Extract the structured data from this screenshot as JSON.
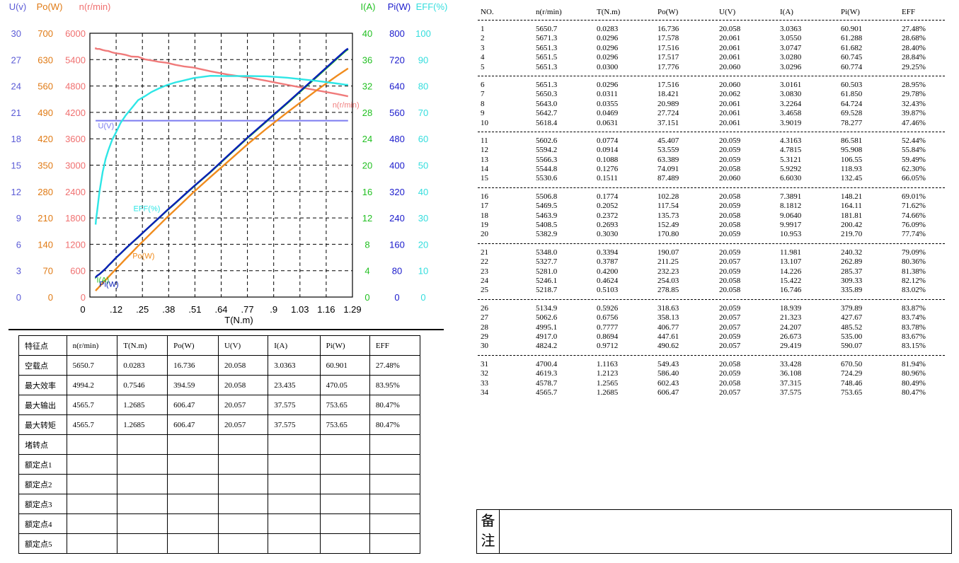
{
  "chart_data": {
    "type": "line",
    "xlabel": "T(N.m)",
    "x_ticks": [
      "0",
      ".12",
      ".25",
      ".38",
      ".51",
      ".64",
      ".77",
      ".9",
      "1.03",
      "1.16",
      "1.29"
    ],
    "xlim": [
      0,
      1.29
    ],
    "grid": true,
    "axes": [
      {
        "label": "U(v)",
        "color": "#5b5bd6",
        "side": "left",
        "min": 0,
        "max": 30,
        "ticks": [
          "0",
          "3",
          "6",
          "9",
          "12",
          "15",
          "18",
          "21",
          "24",
          "27",
          "30"
        ]
      },
      {
        "label": "Po(W)",
        "color": "#e07a14",
        "side": "left",
        "min": 0,
        "max": 700,
        "ticks": [
          "0",
          "70",
          "140",
          "210",
          "280",
          "350",
          "420",
          "490",
          "560",
          "630",
          "700"
        ]
      },
      {
        "label": "n(r/min)",
        "color": "#f07070",
        "side": "left",
        "min": 0,
        "max": 6000,
        "ticks": [
          "0",
          "600",
          "1200",
          "1800",
          "2400",
          "3000",
          "3600",
          "4200",
          "4800",
          "5400",
          "6000"
        ]
      },
      {
        "label": "I(A)",
        "color": "#22c022",
        "side": "right",
        "min": 0,
        "max": 40,
        "ticks": [
          "0",
          "4",
          "8",
          "12",
          "16",
          "20",
          "24",
          "28",
          "32",
          "36",
          "40"
        ]
      },
      {
        "label": "Pi(W)",
        "color": "#1a1acc",
        "side": "right",
        "min": 0,
        "max": 800,
        "ticks": [
          "0",
          "80",
          "160",
          "240",
          "320",
          "400",
          "480",
          "560",
          "640",
          "720",
          "800"
        ]
      },
      {
        "label": "EFF(%)",
        "color": "#33dddd",
        "side": "right",
        "min": 0,
        "max": 100,
        "ticks": [
          "0",
          "10",
          "20",
          "30",
          "40",
          "50",
          "60",
          "70",
          "80",
          "90",
          "100"
        ]
      }
    ],
    "series": [
      {
        "name": "n(r/min)",
        "axis": 2,
        "color": "#f07b7b"
      },
      {
        "name": "U(V)",
        "axis": 0,
        "color": "#7b7bf0"
      },
      {
        "name": "Po(W)",
        "axis": 1,
        "color": "#f08c1e"
      },
      {
        "name": "I(A)",
        "axis": 3,
        "color": "#22c022"
      },
      {
        "name": "Pi(W)",
        "axis": 4,
        "color": "#0a1fb8"
      },
      {
        "name": "EFF(%)",
        "axis": 5,
        "color": "#2ee6e6"
      }
    ],
    "curve_labels": [
      {
        "series": 0,
        "text": "n(r/min)"
      },
      {
        "series": 1,
        "text": "U(V)"
      },
      {
        "series": 2,
        "text": "Po(W)"
      },
      {
        "series": 3,
        "text": "I(A)"
      },
      {
        "series": 4,
        "text": "Pi(W)"
      },
      {
        "series": 5,
        "text": "EFF(%)"
      }
    ]
  },
  "columns": [
    "NO.",
    "n(r/min)",
    "T(N.m)",
    "Po(W)",
    "U(V)",
    "I(A)",
    "Pi(W)",
    "EFF"
  ],
  "rows": [
    [
      "1",
      "5650.7",
      "0.0283",
      "16.736",
      "20.058",
      "3.0363",
      "60.901",
      "27.48%"
    ],
    [
      "2",
      "5671.3",
      "0.0296",
      "17.578",
      "20.061",
      "3.0550",
      "61.288",
      "28.68%"
    ],
    [
      "3",
      "5651.3",
      "0.0296",
      "17.516",
      "20.061",
      "3.0747",
      "61.682",
      "28.40%"
    ],
    [
      "4",
      "5651.5",
      "0.0296",
      "17.517",
      "20.061",
      "3.0280",
      "60.745",
      "28.84%"
    ],
    [
      "5",
      "5651.3",
      "0.0300",
      "17.776",
      "20.060",
      "3.0296",
      "60.774",
      "29.25%"
    ],
    [
      "6",
      "5651.3",
      "0.0296",
      "17.516",
      "20.060",
      "3.0161",
      "60.503",
      "28.95%"
    ],
    [
      "7",
      "5650.3",
      "0.0311",
      "18.421",
      "20.062",
      "3.0830",
      "61.850",
      "29.78%"
    ],
    [
      "8",
      "5643.0",
      "0.0355",
      "20.989",
      "20.061",
      "3.2264",
      "64.724",
      "32.43%"
    ],
    [
      "9",
      "5642.7",
      "0.0469",
      "27.724",
      "20.061",
      "3.4658",
      "69.528",
      "39.87%"
    ],
    [
      "10",
      "5618.4",
      "0.0631",
      "37.151",
      "20.061",
      "3.9019",
      "78.277",
      "47.46%"
    ],
    [
      "11",
      "5602.6",
      "0.0774",
      "45.407",
      "20.059",
      "4.3163",
      "86.581",
      "52.44%"
    ],
    [
      "12",
      "5594.2",
      "0.0914",
      "53.559",
      "20.059",
      "4.7815",
      "95.908",
      "55.84%"
    ],
    [
      "13",
      "5566.3",
      "0.1088",
      "63.389",
      "20.059",
      "5.3121",
      "106.55",
      "59.49%"
    ],
    [
      "14",
      "5544.8",
      "0.1276",
      "74.091",
      "20.058",
      "5.9292",
      "118.93",
      "62.30%"
    ],
    [
      "15",
      "5530.6",
      "0.1511",
      "87.489",
      "20.060",
      "6.6030",
      "132.45",
      "66.05%"
    ],
    [
      "16",
      "5506.8",
      "0.1774",
      "102.28",
      "20.058",
      "7.3891",
      "148.21",
      "69.01%"
    ],
    [
      "17",
      "5469.5",
      "0.2052",
      "117.54",
      "20.059",
      "8.1812",
      "164.11",
      "71.62%"
    ],
    [
      "18",
      "5463.9",
      "0.2372",
      "135.73",
      "20.058",
      "9.0640",
      "181.81",
      "74.66%"
    ],
    [
      "19",
      "5408.5",
      "0.2693",
      "152.49",
      "20.058",
      "9.9917",
      "200.42",
      "76.09%"
    ],
    [
      "20",
      "5382.9",
      "0.3030",
      "170.80",
      "20.059",
      "10.953",
      "219.70",
      "77.74%"
    ],
    [
      "21",
      "5348.0",
      "0.3394",
      "190.07",
      "20.059",
      "11.981",
      "240.32",
      "79.09%"
    ],
    [
      "22",
      "5327.7",
      "0.3787",
      "211.25",
      "20.057",
      "13.107",
      "262.89",
      "80.36%"
    ],
    [
      "23",
      "5281.0",
      "0.4200",
      "232.23",
      "20.059",
      "14.226",
      "285.37",
      "81.38%"
    ],
    [
      "24",
      "5246.1",
      "0.4624",
      "254.03",
      "20.058",
      "15.422",
      "309.33",
      "82.12%"
    ],
    [
      "25",
      "5218.7",
      "0.5103",
      "278.85",
      "20.058",
      "16.746",
      "335.89",
      "83.02%"
    ],
    [
      "26",
      "5134.9",
      "0.5926",
      "318.63",
      "20.059",
      "18.939",
      "379.89",
      "83.87%"
    ],
    [
      "27",
      "5062.6",
      "0.6756",
      "358.13",
      "20.057",
      "21.323",
      "427.67",
      "83.74%"
    ],
    [
      "28",
      "4995.1",
      "0.7777",
      "406.77",
      "20.057",
      "24.207",
      "485.52",
      "83.78%"
    ],
    [
      "29",
      "4917.0",
      "0.8694",
      "447.61",
      "20.059",
      "26.673",
      "535.00",
      "83.67%"
    ],
    [
      "30",
      "4824.2",
      "0.9712",
      "490.62",
      "20.057",
      "29.419",
      "590.07",
      "83.15%"
    ],
    [
      "31",
      "4700.4",
      "1.1163",
      "549.43",
      "20.058",
      "33.428",
      "670.50",
      "81.94%"
    ],
    [
      "32",
      "4619.3",
      "1.2123",
      "586.40",
      "20.059",
      "36.108",
      "724.29",
      "80.96%"
    ],
    [
      "33",
      "4578.7",
      "1.2565",
      "602.43",
      "20.058",
      "37.315",
      "748.46",
      "80.49%"
    ],
    [
      "34",
      "4565.7",
      "1.2685",
      "606.47",
      "20.057",
      "37.575",
      "753.65",
      "80.47%"
    ]
  ],
  "feature_table": {
    "headers": [
      "特征点",
      "n(r/min)",
      "T(N.m)",
      "Po(W)",
      "U(V)",
      "I(A)",
      "Pi(W)",
      "EFF"
    ],
    "rows": [
      [
        "空载点",
        "5650.7",
        "0.0283",
        "16.736",
        "20.058",
        "3.0363",
        "60.901",
        "27.48%"
      ],
      [
        "最大效率",
        "4994.2",
        "0.7546",
        "394.59",
        "20.058",
        "23.435",
        "470.05",
        "83.95%"
      ],
      [
        "最大输出",
        "4565.7",
        "1.2685",
        "606.47",
        "20.057",
        "37.575",
        "753.65",
        "80.47%"
      ],
      [
        "最大转矩",
        "4565.7",
        "1.2685",
        "606.47",
        "20.057",
        "37.575",
        "753.65",
        "80.47%"
      ],
      [
        "堵转点",
        "",
        "",
        "",
        "",
        "",
        "",
        ""
      ],
      [
        "额定点1",
        "",
        "",
        "",
        "",
        "",
        "",
        ""
      ],
      [
        "额定点2",
        "",
        "",
        "",
        "",
        "",
        "",
        ""
      ],
      [
        "额定点3",
        "",
        "",
        "",
        "",
        "",
        "",
        ""
      ],
      [
        "额定点4",
        "",
        "",
        "",
        "",
        "",
        "",
        ""
      ],
      [
        "额定点5",
        "",
        "",
        "",
        "",
        "",
        "",
        ""
      ]
    ]
  },
  "remark": {
    "label_1": "备",
    "label_2": "注",
    "content": ""
  }
}
